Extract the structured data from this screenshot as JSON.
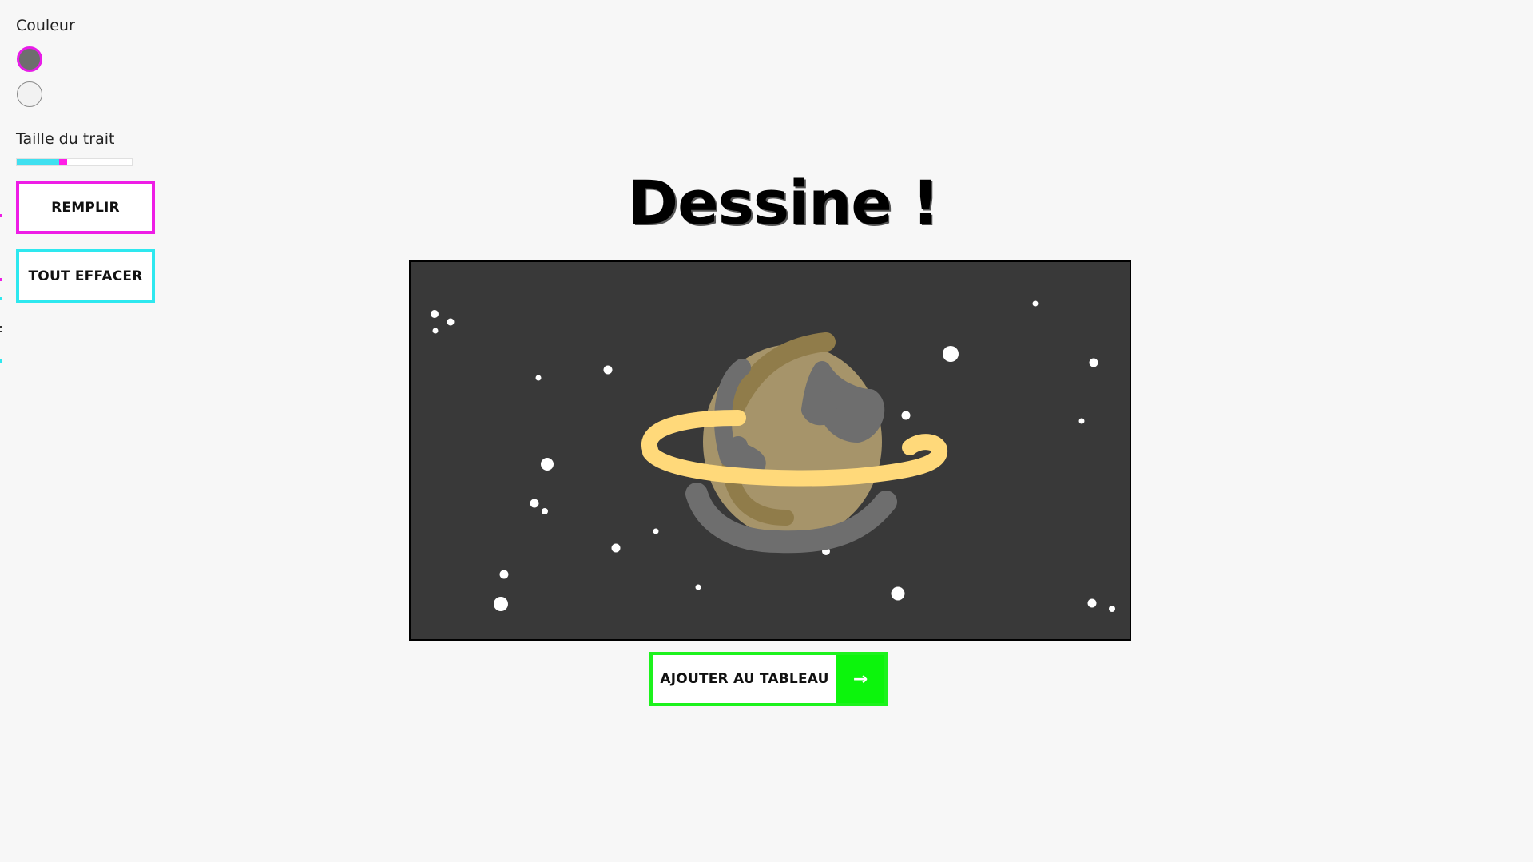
{
  "sidebar": {
    "color_label": "Couleur",
    "colors": [
      {
        "name": "dark-gray",
        "hex": "#6e6e6e",
        "selected": true
      },
      {
        "name": "light-gray",
        "hex": "#f2f2f2",
        "selected": false
      }
    ],
    "selected_ring_color": "#e81ce8",
    "stroke_label": "Taille du trait",
    "stroke_value_fraction": 0.4,
    "fill_button": "REMPLIR",
    "clear_button": "TOUT EFFACER"
  },
  "main": {
    "title": "Dessine !",
    "canvas_background": "#393939",
    "add_button": "AJOUTER AU TABLEAU",
    "add_button_icon": "arrow-right-icon",
    "add_button_arrow": "→"
  },
  "colors": {
    "accent_magenta": "#ee1de6",
    "accent_cyan": "#2ee8ef",
    "accent_green": "#1df21d",
    "page_background": "#f7f7f7"
  }
}
